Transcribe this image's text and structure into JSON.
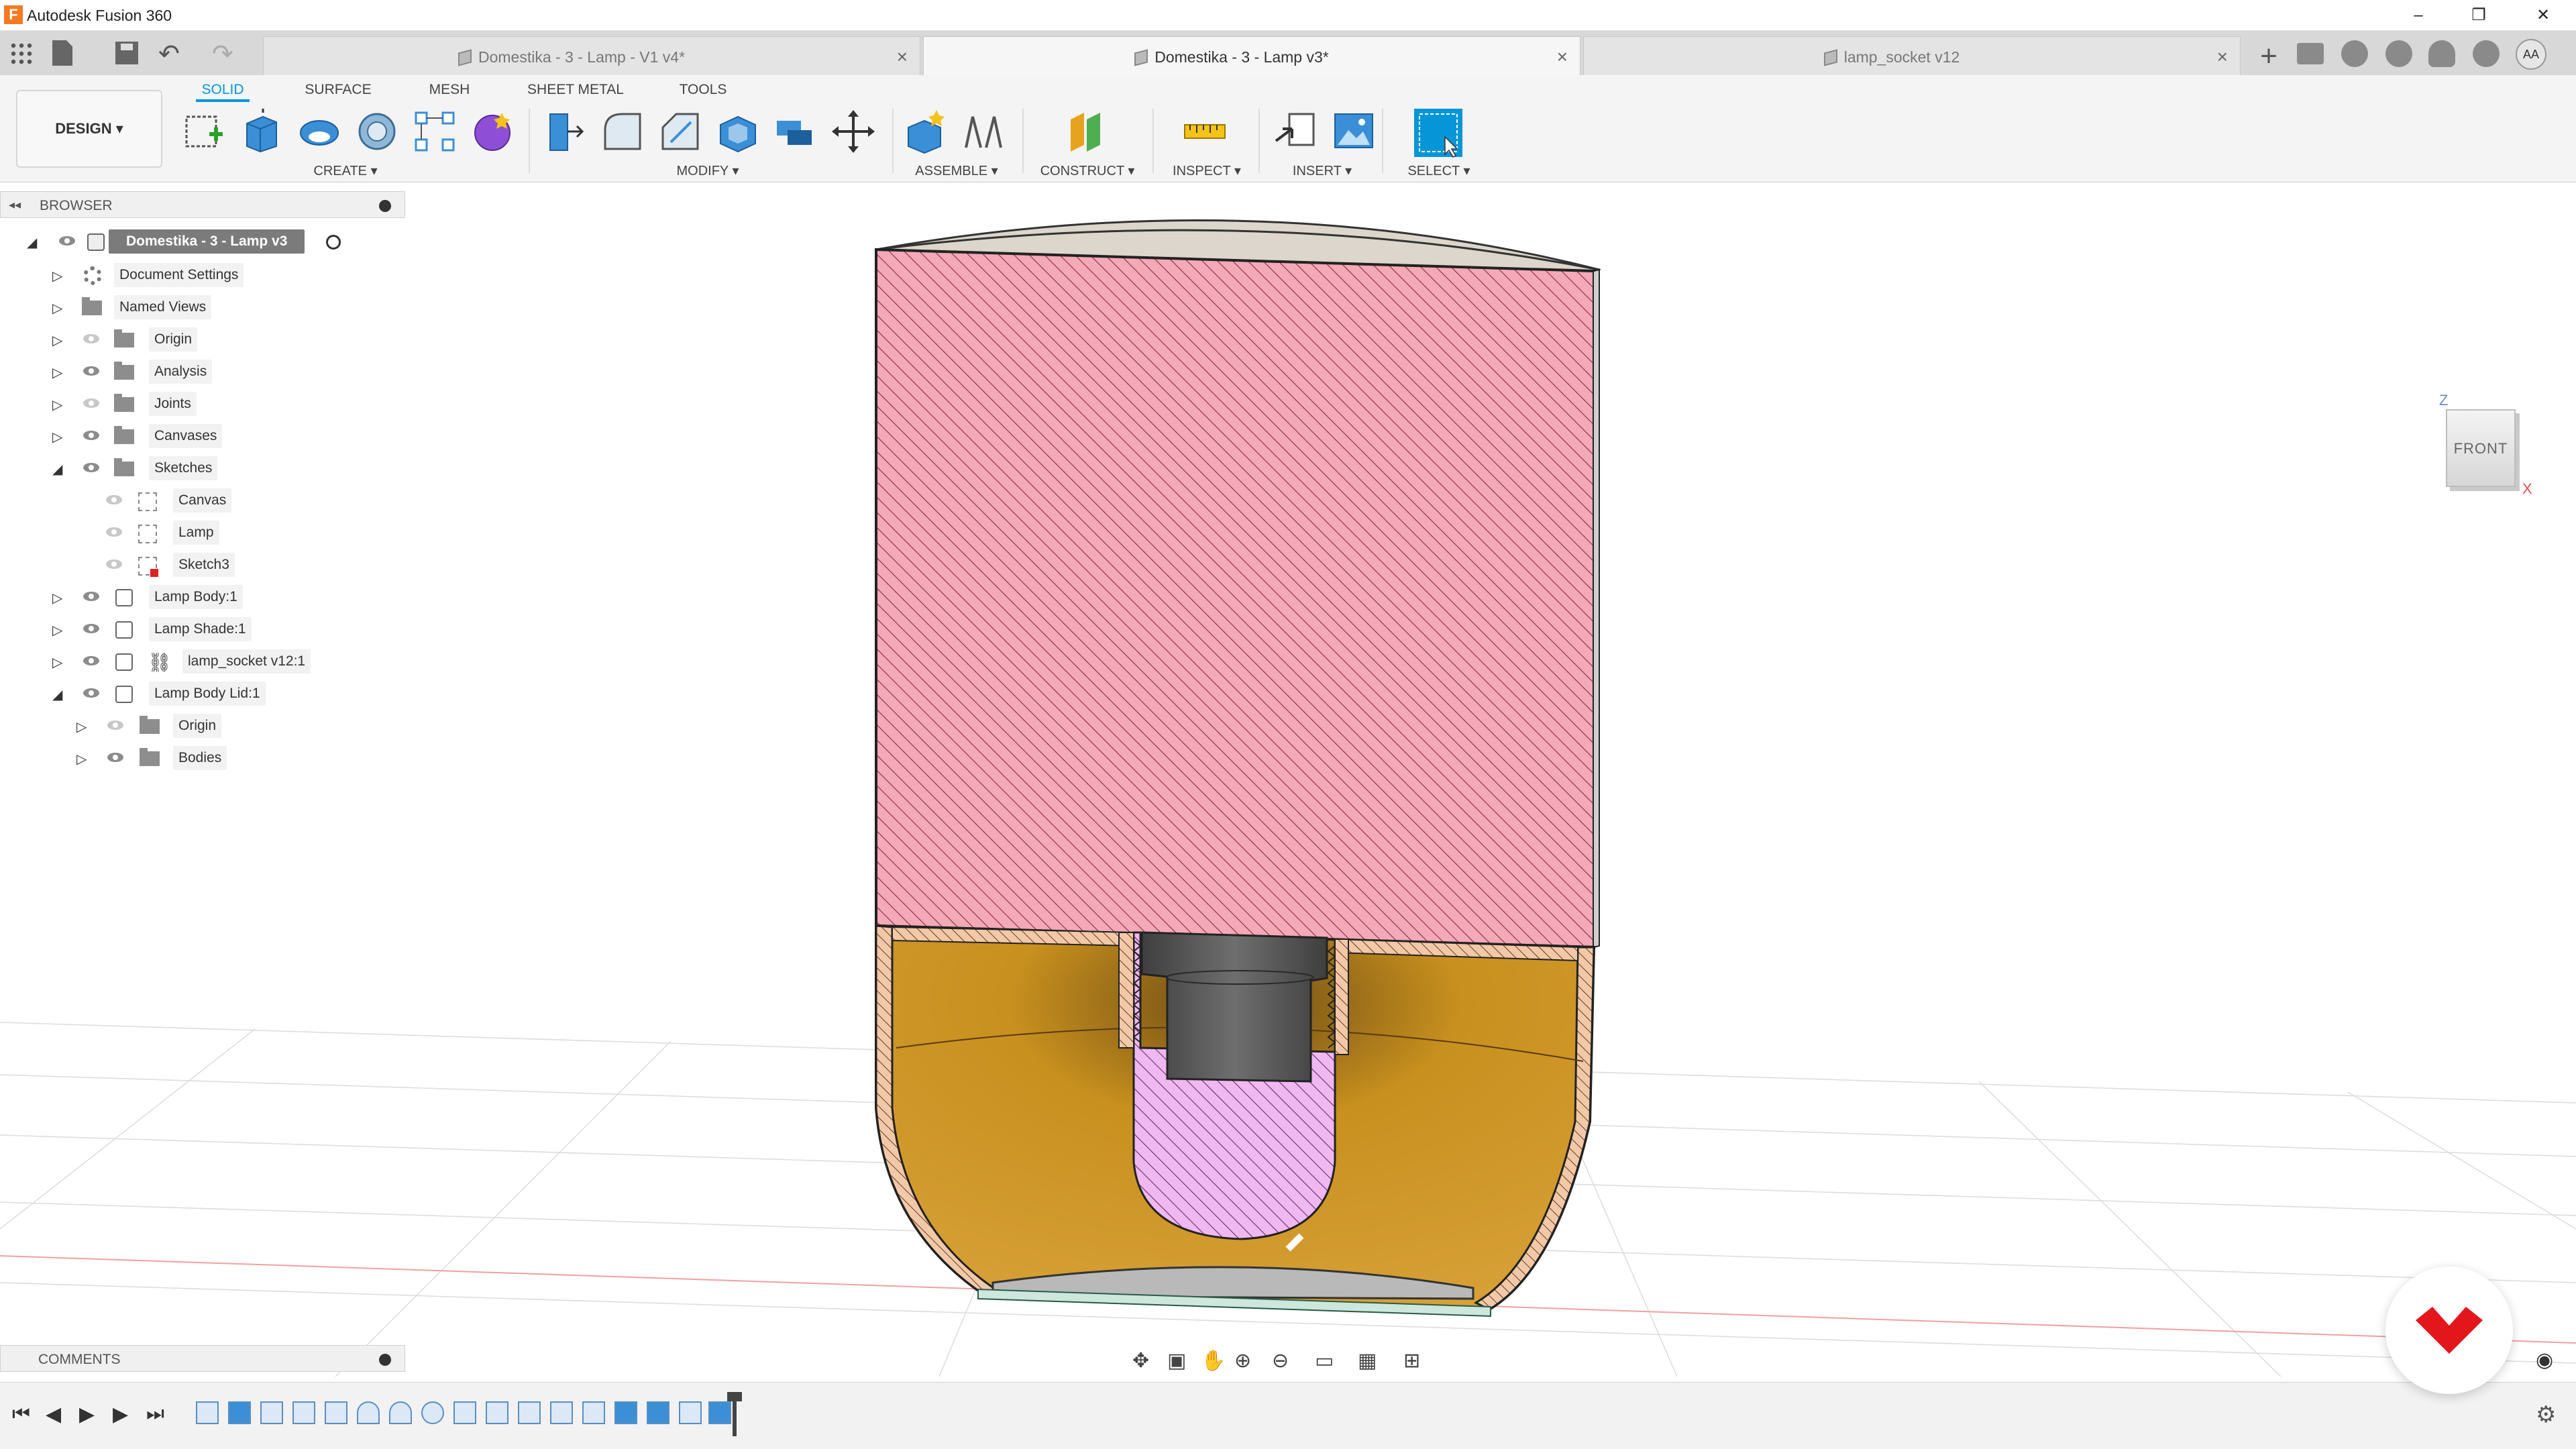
{
  "window": {
    "title": "Autodesk Fusion 360",
    "logo_letter": "F",
    "minimize": "–",
    "restore": "❐",
    "close": "✕"
  },
  "tabs": [
    {
      "label": "Domestika - 3 - Lamp - V1 v4*",
      "active": false
    },
    {
      "label": "Domestika - 3 - Lamp v3*",
      "active": true
    },
    {
      "label": "lamp_socket v12",
      "active": false
    }
  ],
  "tab_close": "×",
  "new_tab": "+",
  "profile_initials": "AA",
  "toolbar": {
    "workspace_button": "DESIGN ▾",
    "workspace_tabs": [
      "SOLID",
      "SURFACE",
      "MESH",
      "SHEET METAL",
      "TOOLS"
    ],
    "groups": [
      "CREATE ▾",
      "MODIFY ▾",
      "ASSEMBLE ▾",
      "CONSTRUCT ▾",
      "INSPECT ▾",
      "INSERT ▾",
      "SELECT ▾"
    ]
  },
  "browser": {
    "title": "BROWSER",
    "collapse": "◂◂",
    "items": [
      {
        "label": "Domestika - 3 - Lamp v3",
        "level": 0,
        "expanded": true,
        "icon": "document-icon"
      },
      {
        "label": "Document Settings",
        "level": 1,
        "expanded": false,
        "icon": "gear-icon"
      },
      {
        "label": "Named Views",
        "level": 1,
        "expanded": false,
        "icon": "folder-icon"
      },
      {
        "label": "Origin",
        "level": 1,
        "expanded": false,
        "icon": "folder-icon",
        "eye": "hidden"
      },
      {
        "label": "Analysis",
        "level": 1,
        "expanded": false,
        "icon": "folder-icon",
        "eye": "visible"
      },
      {
        "label": "Joints",
        "level": 1,
        "expanded": false,
        "icon": "folder-icon",
        "eye": "hidden"
      },
      {
        "label": "Canvases",
        "level": 1,
        "expanded": false,
        "icon": "folder-icon",
        "eye": "visible"
      },
      {
        "label": "Sketches",
        "level": 1,
        "expanded": true,
        "icon": "folder-icon",
        "eye": "visible"
      },
      {
        "label": "Canvas",
        "level": 2,
        "icon": "sketch-icon",
        "eye": "hidden"
      },
      {
        "label": "Lamp",
        "level": 2,
        "icon": "sketch-icon",
        "eye": "hidden"
      },
      {
        "label": "Sketch3",
        "level": 2,
        "icon": "sketch-error-icon",
        "eye": "hidden"
      },
      {
        "label": "Lamp Body:1",
        "level": 1,
        "expanded": false,
        "icon": "component-icon",
        "eye": "visible"
      },
      {
        "label": "Lamp Shade:1",
        "level": 1,
        "expanded": false,
        "icon": "component-icon",
        "eye": "visible"
      },
      {
        "label": "lamp_socket v12:1",
        "level": 1,
        "expanded": false,
        "icon": "linked-component-icon",
        "eye": "visible"
      },
      {
        "label": "Lamp Body Lid:1",
        "level": 1,
        "expanded": true,
        "icon": "component-icon",
        "eye": "visible"
      },
      {
        "label": "Origin",
        "level": 2,
        "expanded": false,
        "icon": "folder-icon",
        "eye": "hidden"
      },
      {
        "label": "Bodies",
        "level": 2,
        "expanded": false,
        "icon": "folder-icon",
        "eye": "visible"
      }
    ]
  },
  "comments": {
    "title": "COMMENTS"
  },
  "viewcube": {
    "face": "FRONT",
    "axis_z": "Z",
    "axis_x": "X"
  },
  "colors": {
    "accent": "#0696d7",
    "shade_section": "#f4a9b8",
    "shade_hatch": "#8a2a3a",
    "body_section": "#f2c9a8",
    "body_interior": "#c8901e",
    "socket_section": "#f0b8f0",
    "socket_metal": "#5a5a5a",
    "cap": "#ddd6cc",
    "logo_red": "#e3161b"
  }
}
